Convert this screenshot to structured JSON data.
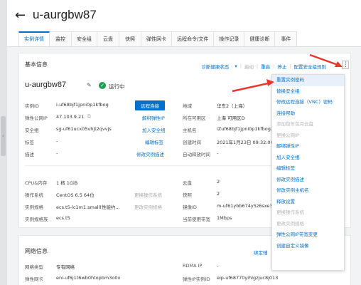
{
  "header": {
    "title": "u-aurgbw87"
  },
  "tabs": [
    {
      "label": "实例详情",
      "active": true
    },
    {
      "label": "监控"
    },
    {
      "label": "安全组"
    },
    {
      "label": "云盘"
    },
    {
      "label": "快照"
    },
    {
      "label": "弹性网卡"
    },
    {
      "label": "远程命令/文件"
    },
    {
      "label": "操作记录"
    },
    {
      "label": "健康诊断"
    },
    {
      "label": "事件"
    }
  ],
  "basic": {
    "section_title": "基本信息",
    "toolbar": {
      "diagnose": "诊断健康状态",
      "start": "启动",
      "restart": "重启",
      "stop": "停止",
      "sg_rules": "配置安全组规则"
    },
    "instance_name": "u-aurgbw87",
    "status": "运行中",
    "rows": {
      "instance_id": {
        "label": "实例ID",
        "value": "i-uf68bjf1jpni0p1kfbog",
        "action": "远程连接"
      },
      "eip": {
        "label": "弹性公网IP",
        "value": "47.103.9.21",
        "action": "解绑弹性IP"
      },
      "sg": {
        "label": "安全组",
        "value": "sg-uf61ucx05vhjt2qvvjs",
        "action": "加入安全组"
      },
      "tag": {
        "label": "标签",
        "value": "-",
        "action": "编辑标签"
      },
      "desc": {
        "label": "描述",
        "value": "-",
        "action": "修改实例描述"
      },
      "region": {
        "label": "地域",
        "value": "华东2（上海）"
      },
      "zone": {
        "label": "所在可用区",
        "value": "上海 可用区D"
      },
      "hostname": {
        "label": "主机名",
        "value": "iZuf68bjf1jpni0p1kfbogZ"
      },
      "created": {
        "label": "创建时间",
        "value": "2021年1月23日 09:32:00"
      },
      "autorelease": {
        "label": "自动释放时间",
        "value": "-"
      },
      "cpu": {
        "label": "CPU&内存",
        "value": "1 核 1GiB"
      },
      "os": {
        "label": "操作系统",
        "value": "CentOS 6.5 64位",
        "action": "更换操作系统"
      },
      "spec": {
        "label": "实例规格",
        "value": "ecs.t5-lc1m1.small(性能约...",
        "action": "更改实例规格"
      },
      "family": {
        "label": "实例规格族",
        "value": "ecs.t5"
      },
      "disk": {
        "label": "云盘",
        "value": "2"
      },
      "snapshot": {
        "label": "快照",
        "value": "2"
      },
      "image": {
        "label": "镜像ID",
        "value": "m-uf61ybb674y5z6sxe32"
      },
      "bandwidth": {
        "label": "当前使用带宽",
        "value": "1Mbps"
      }
    }
  },
  "network": {
    "section_title": "网络信息",
    "bind_action": "绑定辅",
    "rows": {
      "nettype": {
        "label": "网络类型",
        "value": "专有网络"
      },
      "eni": {
        "label": "弹性网卡",
        "value": "eni-uf6j1t6wb0htopbm3o0x"
      },
      "rdma": {
        "label": "RDMA IP",
        "value": "-"
      },
      "eipid": {
        "label": "弹性IP实例ID",
        "value": "eip-uf68770yihlgzjuc8j013"
      }
    }
  },
  "menu": {
    "items": [
      {
        "label": "重置实例密码",
        "enabled": true,
        "highlight": true
      },
      {
        "label": "替换安全组",
        "enabled": true
      },
      {
        "label": "修改远程连接（VNC）密码",
        "enabled": true
      },
      {
        "label": "连接帮助",
        "enabled": true
      },
      {
        "label": "添加包年包月云盘",
        "enabled": false
      },
      {
        "label": "更换公网IP",
        "enabled": false
      },
      {
        "label": "解绑弹性IP",
        "enabled": true
      },
      {
        "label": "加入安全组",
        "enabled": true
      },
      {
        "label": "编辑标签",
        "enabled": true
      },
      {
        "label": "修改实例描述",
        "enabled": true
      },
      {
        "label": "修改实例主机名",
        "enabled": true
      },
      {
        "label": "释放设置",
        "enabled": true
      },
      {
        "label": "更换操作系统",
        "enabled": false
      },
      {
        "label": "更改实例规格",
        "enabled": false
      },
      {
        "label": "弹性公网IP带宽变更",
        "enabled": true
      },
      {
        "label": "创建自定义镜像",
        "enabled": true
      }
    ]
  },
  "colors": {
    "accent": "#0070cc",
    "status": "#1e9e51",
    "arrow": "#e8372c"
  }
}
